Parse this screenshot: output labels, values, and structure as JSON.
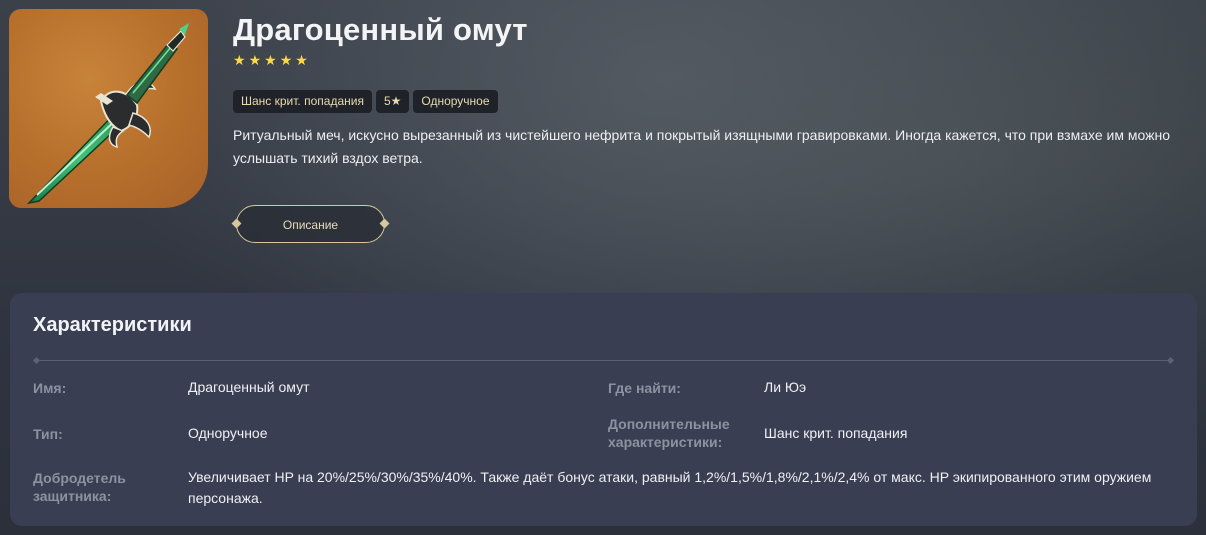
{
  "weapon": {
    "name": "Драгоценный омут",
    "stars": [
      "★",
      "★",
      "★",
      "★",
      "★"
    ],
    "tags": [
      "Шанс крит. попадания",
      "5★",
      "Одноручное"
    ],
    "description": "Ритуальный меч, искусно вырезанный из чистейшего нефрита и покрытый изящными гравировками. Иногда кажется, что при взмахе им можно услышать тихий вздох ветра.",
    "description_button": "Описание"
  },
  "characteristics": {
    "title": "Характеристики",
    "rows": {
      "name": {
        "label": "Имя:",
        "value": "Драгоценный омут"
      },
      "where": {
        "label": "Где найти:",
        "value": "Ли Юэ"
      },
      "type": {
        "label": "Тип:",
        "value": "Одноручное"
      },
      "extra": {
        "label": "Дополнительные характеристики:",
        "value": "Шанс крит. попадания"
      },
      "virtue": {
        "label": "Добродетель защитника:",
        "value": "Увеличивает HP на 20%/25%/30%/35%/40%. Также даёт бонус атаки, равный 1,2%/1,5%/1,8%/2,1%/2,4% от макс. HP экипированного этим оружием персонажа."
      }
    }
  },
  "colors": {
    "star": "#ffd84a",
    "card_bg": "#b66f2b",
    "panel_bg": "#393e52",
    "accent_border": "#d6c79c"
  },
  "icons": {
    "weapon_image": "jade-sword-icon"
  }
}
